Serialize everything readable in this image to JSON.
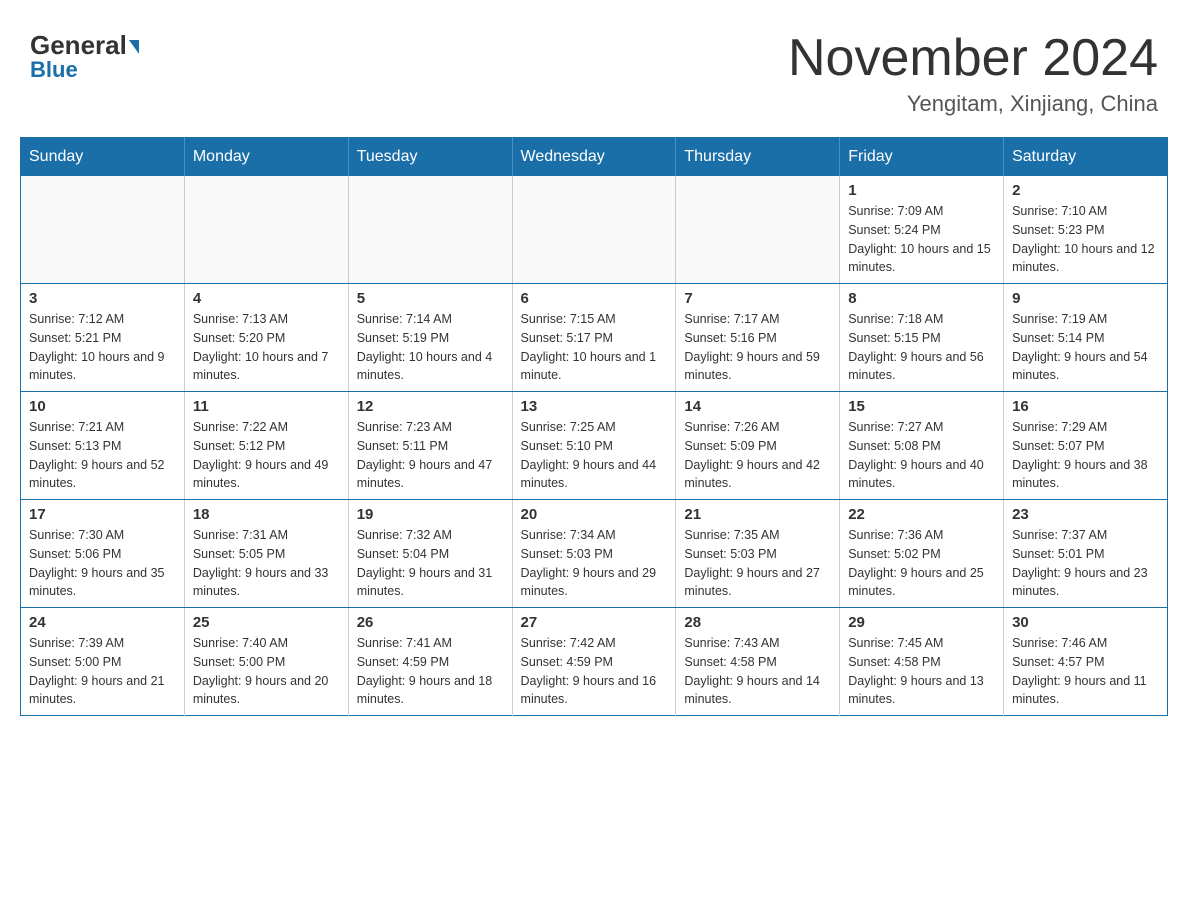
{
  "header": {
    "logo_general": "General",
    "logo_blue": "Blue",
    "month_title": "November 2024",
    "location": "Yengitam, Xinjiang, China"
  },
  "weekdays": [
    "Sunday",
    "Monday",
    "Tuesday",
    "Wednesday",
    "Thursday",
    "Friday",
    "Saturday"
  ],
  "weeks": [
    [
      {
        "day": "",
        "info": ""
      },
      {
        "day": "",
        "info": ""
      },
      {
        "day": "",
        "info": ""
      },
      {
        "day": "",
        "info": ""
      },
      {
        "day": "",
        "info": ""
      },
      {
        "day": "1",
        "info": "Sunrise: 7:09 AM\nSunset: 5:24 PM\nDaylight: 10 hours and 15 minutes."
      },
      {
        "day": "2",
        "info": "Sunrise: 7:10 AM\nSunset: 5:23 PM\nDaylight: 10 hours and 12 minutes."
      }
    ],
    [
      {
        "day": "3",
        "info": "Sunrise: 7:12 AM\nSunset: 5:21 PM\nDaylight: 10 hours and 9 minutes."
      },
      {
        "day": "4",
        "info": "Sunrise: 7:13 AM\nSunset: 5:20 PM\nDaylight: 10 hours and 7 minutes."
      },
      {
        "day": "5",
        "info": "Sunrise: 7:14 AM\nSunset: 5:19 PM\nDaylight: 10 hours and 4 minutes."
      },
      {
        "day": "6",
        "info": "Sunrise: 7:15 AM\nSunset: 5:17 PM\nDaylight: 10 hours and 1 minute."
      },
      {
        "day": "7",
        "info": "Sunrise: 7:17 AM\nSunset: 5:16 PM\nDaylight: 9 hours and 59 minutes."
      },
      {
        "day": "8",
        "info": "Sunrise: 7:18 AM\nSunset: 5:15 PM\nDaylight: 9 hours and 56 minutes."
      },
      {
        "day": "9",
        "info": "Sunrise: 7:19 AM\nSunset: 5:14 PM\nDaylight: 9 hours and 54 minutes."
      }
    ],
    [
      {
        "day": "10",
        "info": "Sunrise: 7:21 AM\nSunset: 5:13 PM\nDaylight: 9 hours and 52 minutes."
      },
      {
        "day": "11",
        "info": "Sunrise: 7:22 AM\nSunset: 5:12 PM\nDaylight: 9 hours and 49 minutes."
      },
      {
        "day": "12",
        "info": "Sunrise: 7:23 AM\nSunset: 5:11 PM\nDaylight: 9 hours and 47 minutes."
      },
      {
        "day": "13",
        "info": "Sunrise: 7:25 AM\nSunset: 5:10 PM\nDaylight: 9 hours and 44 minutes."
      },
      {
        "day": "14",
        "info": "Sunrise: 7:26 AM\nSunset: 5:09 PM\nDaylight: 9 hours and 42 minutes."
      },
      {
        "day": "15",
        "info": "Sunrise: 7:27 AM\nSunset: 5:08 PM\nDaylight: 9 hours and 40 minutes."
      },
      {
        "day": "16",
        "info": "Sunrise: 7:29 AM\nSunset: 5:07 PM\nDaylight: 9 hours and 38 minutes."
      }
    ],
    [
      {
        "day": "17",
        "info": "Sunrise: 7:30 AM\nSunset: 5:06 PM\nDaylight: 9 hours and 35 minutes."
      },
      {
        "day": "18",
        "info": "Sunrise: 7:31 AM\nSunset: 5:05 PM\nDaylight: 9 hours and 33 minutes."
      },
      {
        "day": "19",
        "info": "Sunrise: 7:32 AM\nSunset: 5:04 PM\nDaylight: 9 hours and 31 minutes."
      },
      {
        "day": "20",
        "info": "Sunrise: 7:34 AM\nSunset: 5:03 PM\nDaylight: 9 hours and 29 minutes."
      },
      {
        "day": "21",
        "info": "Sunrise: 7:35 AM\nSunset: 5:03 PM\nDaylight: 9 hours and 27 minutes."
      },
      {
        "day": "22",
        "info": "Sunrise: 7:36 AM\nSunset: 5:02 PM\nDaylight: 9 hours and 25 minutes."
      },
      {
        "day": "23",
        "info": "Sunrise: 7:37 AM\nSunset: 5:01 PM\nDaylight: 9 hours and 23 minutes."
      }
    ],
    [
      {
        "day": "24",
        "info": "Sunrise: 7:39 AM\nSunset: 5:00 PM\nDaylight: 9 hours and 21 minutes."
      },
      {
        "day": "25",
        "info": "Sunrise: 7:40 AM\nSunset: 5:00 PM\nDaylight: 9 hours and 20 minutes."
      },
      {
        "day": "26",
        "info": "Sunrise: 7:41 AM\nSunset: 4:59 PM\nDaylight: 9 hours and 18 minutes."
      },
      {
        "day": "27",
        "info": "Sunrise: 7:42 AM\nSunset: 4:59 PM\nDaylight: 9 hours and 16 minutes."
      },
      {
        "day": "28",
        "info": "Sunrise: 7:43 AM\nSunset: 4:58 PM\nDaylight: 9 hours and 14 minutes."
      },
      {
        "day": "29",
        "info": "Sunrise: 7:45 AM\nSunset: 4:58 PM\nDaylight: 9 hours and 13 minutes."
      },
      {
        "day": "30",
        "info": "Sunrise: 7:46 AM\nSunset: 4:57 PM\nDaylight: 9 hours and 11 minutes."
      }
    ]
  ]
}
